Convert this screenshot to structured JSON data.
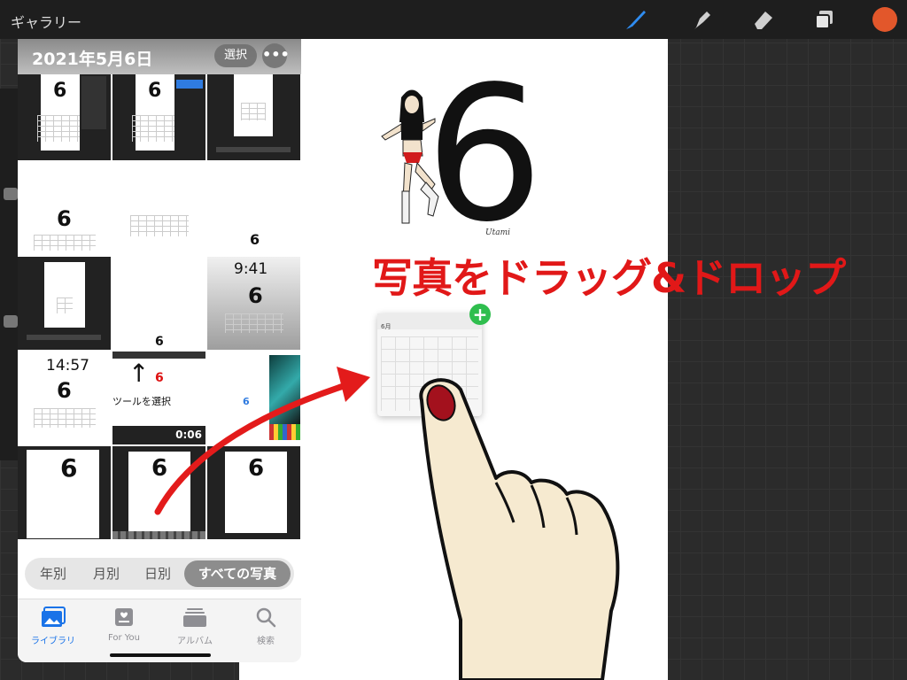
{
  "toolbar": {
    "gallery_label": "ギャラリー",
    "tools": [
      "brush-icon",
      "smudge-icon",
      "eraser-icon",
      "layers-icon"
    ],
    "color": "#e2572b"
  },
  "canvas": {
    "big_number": "6",
    "signature": "Utami"
  },
  "annotation": {
    "text": "写真をドラッグ&ドロップ",
    "color": "#e11818"
  },
  "drag": {
    "badge": "+",
    "badge_color": "#2fbe4e",
    "thumb_month": "6月"
  },
  "photos": {
    "date_title": "2021年5月6日",
    "select_label": "選択",
    "more_label": "•••",
    "thumb_texts": {
      "six": "6",
      "time_1": "9:41",
      "time_2": "14:57",
      "caption": "ツールを選択",
      "duration": "0:06"
    },
    "segments": [
      {
        "label": "年別",
        "active": false
      },
      {
        "label": "月別",
        "active": false
      },
      {
        "label": "日別",
        "active": false
      },
      {
        "label": "すべての写真",
        "active": true
      }
    ],
    "tabs": [
      {
        "label": "ライブラリ",
        "icon": "photo-library-icon",
        "active": true
      },
      {
        "label": "For You",
        "icon": "for-you-icon",
        "active": false
      },
      {
        "label": "アルバム",
        "icon": "albums-icon",
        "active": false
      },
      {
        "label": "検索",
        "icon": "search-icon",
        "active": false
      }
    ],
    "active_tab_color": "#1a73e8"
  }
}
